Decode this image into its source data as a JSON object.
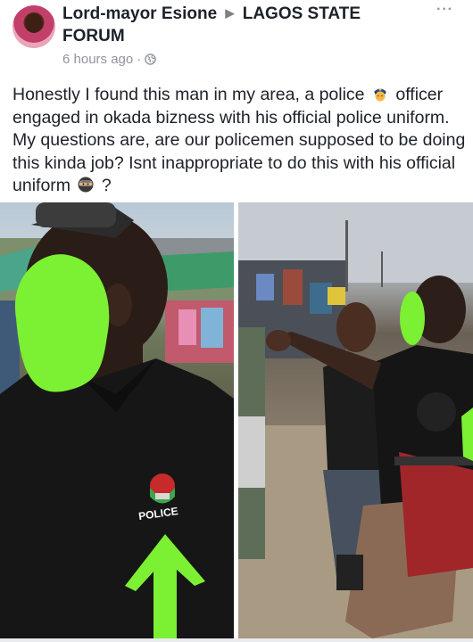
{
  "post": {
    "author": "Lord-mayor Esione",
    "group": "LAGOS STATE FORUM",
    "time": "6 hours ago",
    "separator": "·",
    "more": "···",
    "text_part1": "Honestly I found this man in my area, a police",
    "text_part2": "officer engaged in okada bizness with his official police uniform. My questions are, are our policemen supposed to be doing this kinda job? Isnt inappropriate to do this with his official uniform",
    "text_end": "?"
  },
  "photos": {
    "left": {
      "badge_text": "POLICE"
    },
    "right": {}
  },
  "colors": {
    "redaction": "#7cf033",
    "arrow": "#7cf033",
    "meta_gray": "#90949c"
  },
  "icons": {
    "privacy": "globe-icon",
    "emoji_1": "police-officer-emoji",
    "emoji_2": "ninja-emoji"
  }
}
